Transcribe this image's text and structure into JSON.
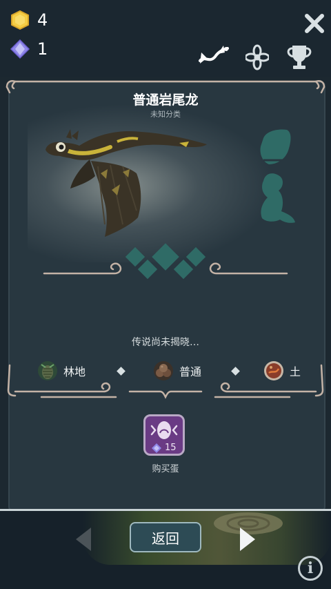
{
  "resources": {
    "coins": "4",
    "gems": "1"
  },
  "tabs": [
    "dragon-tab",
    "flower-tab",
    "trophy-tab"
  ],
  "dragon": {
    "name": "普通岩尾龙",
    "category": "未知分类"
  },
  "legend_text": "传说尚未揭晓…",
  "attributes": [
    {
      "label": "林地",
      "icon": "pinecone-forest-icon"
    },
    {
      "label": "普通",
      "icon": "brown-egg-pile-icon"
    },
    {
      "label": "土",
      "icon": "earth-orb-icon"
    }
  ],
  "buy_egg": {
    "price": "15",
    "label": "购买蛋"
  },
  "nav": {
    "back_label": "返回"
  },
  "colors": {
    "background": "#1c2830",
    "panel": "#283740",
    "frame": "#c4b3a6",
    "teal_silhouette": "#2f6b66",
    "buy_purple": "#6a3b84"
  }
}
